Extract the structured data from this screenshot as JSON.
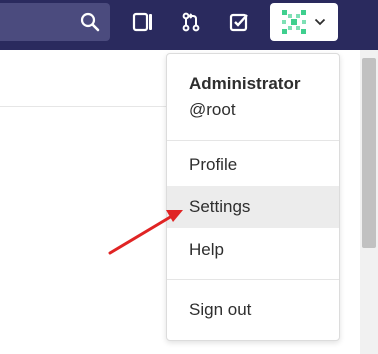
{
  "header": {
    "icons": [
      "search-icon",
      "sidebar-panel-icon",
      "merge-request-icon",
      "todo-check-icon",
      "avatar-icon",
      "chevron-down-icon"
    ]
  },
  "dropdown": {
    "user_name": "Administrator",
    "user_handle": "@root",
    "items": [
      {
        "label": "Profile"
      },
      {
        "label": "Settings"
      },
      {
        "label": "Help"
      },
      {
        "label": "Sign out"
      }
    ]
  },
  "colors": {
    "navbar": "#2a2a5e",
    "search_bg": "#4b4b7e",
    "hover_item": "#ececec",
    "arrow": "#e02424",
    "avatar_green": "#3fcf8e"
  }
}
